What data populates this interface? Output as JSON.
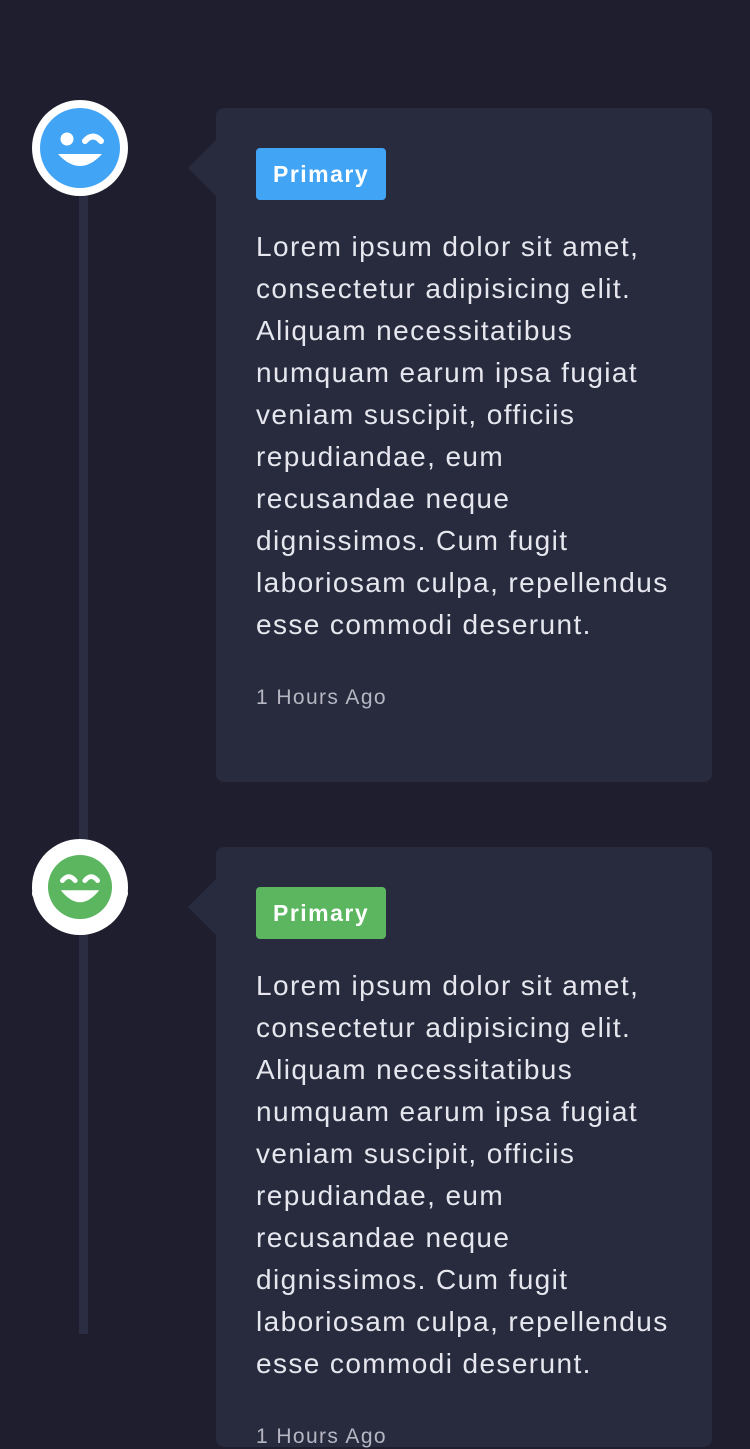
{
  "colors": {
    "background": "#1f1e2e",
    "card": "#282a3e",
    "timeline": "#2b2d42",
    "primary_blue": "#42a4f5",
    "primary_green": "#5cb65f"
  },
  "timeline": {
    "items": [
      {
        "icon": "winking-face-icon",
        "badge": "Primary",
        "badge_color": "#42a4f5",
        "text": "Lorem ipsum dolor sit amet, consectetur adipisicing elit. Aliquam necessitatibus numquam earum ipsa fugiat veniam suscipit, officiis repudiandae, eum recusandae neque dignissimos. Cum fugit laboriosam culpa, repellendus esse commodi deserunt.",
        "time": "1 Hours Ago"
      },
      {
        "icon": "laughing-face-icon",
        "badge": "Primary",
        "badge_color": "#5cb65f",
        "text": "Lorem ipsum dolor sit amet, consectetur adipisicing elit. Aliquam necessitatibus numquam earum ipsa fugiat veniam suscipit, officiis repudiandae, eum recusandae neque dignissimos. Cum fugit laboriosam culpa, repellendus esse commodi deserunt.",
        "time": "1 Hours Ago"
      }
    ]
  }
}
